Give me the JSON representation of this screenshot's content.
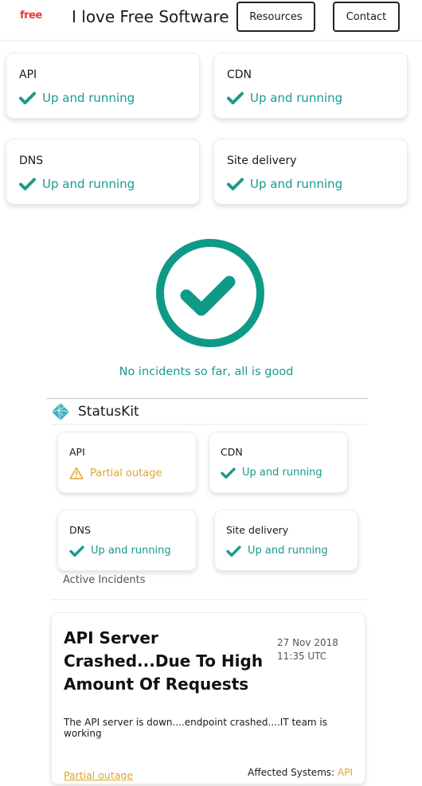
{
  "header": {
    "logo_text": "free",
    "site_title": "I love Free Software",
    "nav": [
      {
        "label": "Resources"
      },
      {
        "label": "Contact"
      }
    ]
  },
  "services": [
    {
      "name": "API",
      "status": "Up and running",
      "state": "ok"
    },
    {
      "name": "CDN",
      "status": "Up and running",
      "state": "ok"
    },
    {
      "name": "DNS",
      "status": "Up and running",
      "state": "ok"
    },
    {
      "name": "Site delivery",
      "status": "Up and running",
      "state": "ok"
    }
  ],
  "summary": {
    "icon": "check-circle-icon",
    "message": "No incidents so far, all is good"
  },
  "statuskit": {
    "brand": "StatusKit",
    "services": [
      {
        "name": "API",
        "status": "Partial outage",
        "state": "warning"
      },
      {
        "name": "CDN",
        "status": "Up and running",
        "state": "ok"
      },
      {
        "name": "DNS",
        "status": "Up and running",
        "state": "ok"
      },
      {
        "name": "Site delivery",
        "status": "Up and running",
        "state": "ok"
      }
    ],
    "active_incidents_label": "Active Incidents",
    "incident": {
      "title": "API Server Crashed...Due To High Amount Of Requests",
      "date": "27 Nov 2018",
      "time": "11:35 UTC",
      "description": "The API server is down....endpoint crashed....IT team is working",
      "impact": "Partial outage",
      "affected_label": "Affected Systems:",
      "affected_systems": "API"
    }
  },
  "colors": {
    "ok": "#1a9a8b",
    "warning": "#e0a52a",
    "logo": "#e53935"
  }
}
